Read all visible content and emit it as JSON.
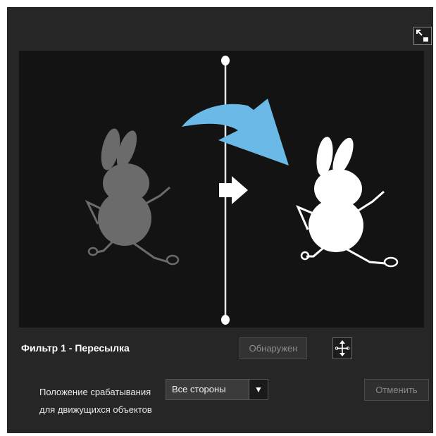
{
  "filter": {
    "title": "Фильтр 1 - Пересылка",
    "detected_label": "Обнаружен",
    "position_label_line1": "Положение срабатывания",
    "position_label_line2": "для движущихся объектов",
    "direction_selected": "Все стороны",
    "cancel_label": "Отменить"
  },
  "icons": {
    "expand": "expand-icon",
    "move": "move-arrows-icon",
    "dropdown": "triangle-down-icon",
    "direction": "arrow-right-icon",
    "curved": "curved-arrow-icon"
  },
  "colors": {
    "panel": "#262626",
    "canvas": "#131313",
    "arrow": "#6ab9e6",
    "figure_before": "#6b6b6b",
    "figure_after": "#ffffff"
  }
}
